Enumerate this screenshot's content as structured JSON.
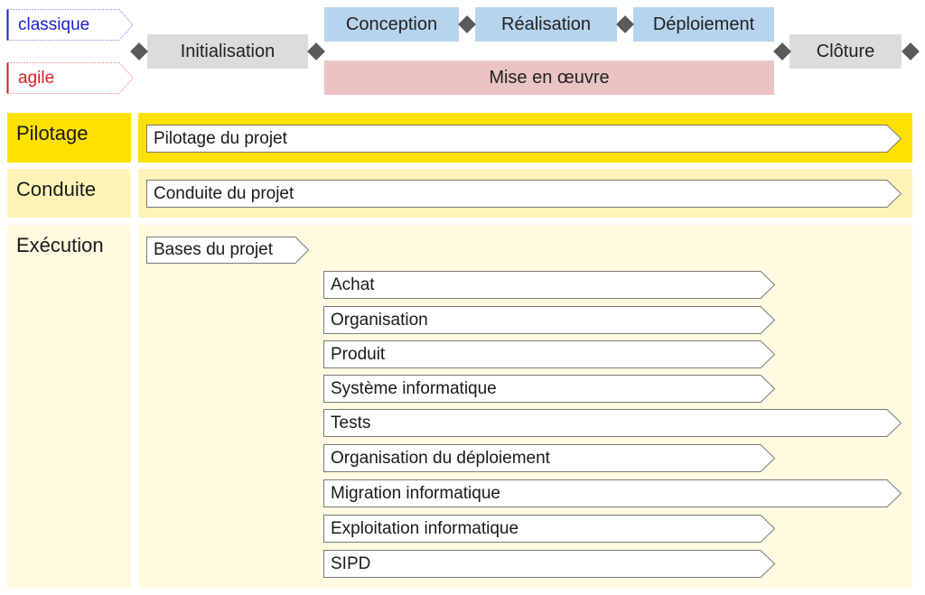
{
  "methods": {
    "classique": {
      "label": "classique",
      "color": "#1f1fd0"
    },
    "agile": {
      "label": "agile",
      "color": "#d01f1f"
    }
  },
  "phases": {
    "initialisation": "Initialisation",
    "conception": "Conception",
    "realisation": "Réalisation",
    "deploiement": "Déploiement",
    "mise_en_oeuvre": "Mise en œuvre",
    "cloture": "Clôture"
  },
  "colors": {
    "phase_neutral": "#dcdcdc",
    "phase_classique": "#b7d4ee",
    "phase_agile": "#eac3c3",
    "lane_pilotage": "#ffe100",
    "lane_conduite": "#fff4b8",
    "lane_execution": "#fffae0",
    "milestone": "#5a5a5a"
  },
  "lanes": {
    "pilotage": {
      "label": "Pilotage",
      "activity": "Pilotage du projet"
    },
    "conduite": {
      "label": "Conduite",
      "activity": "Conduite du projet"
    },
    "execution": {
      "label": "Exécution",
      "activities": [
        "Bases du projet",
        "Achat",
        "Organisation",
        "Produit",
        "Système informatique",
        "Tests",
        "Organisation du déploiement",
        "Migration informatique",
        "Exploitation informatique",
        "SIPD"
      ]
    }
  }
}
